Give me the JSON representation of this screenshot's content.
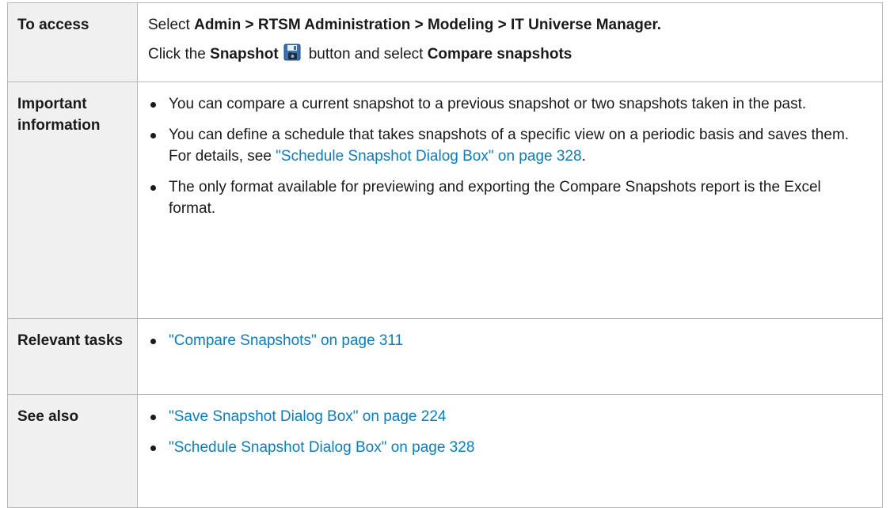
{
  "rows": [
    {
      "label": "To access",
      "line1": {
        "t1": "Select ",
        "path": "Admin > RTSM Administration > Modeling > IT Universe Manager."
      },
      "line2": {
        "t1": "Click the ",
        "b1": "Snapshot",
        "icon": "floppy-camera-icon",
        "t2": "button and select ",
        "b2": "Compare snapshots"
      }
    },
    {
      "label": "Important information",
      "bullets": [
        {
          "text": "You can compare a current snapshot to a previous snapshot or two snapshots taken in the past."
        },
        {
          "text": "You can define a schedule that takes snapshots of a specific view on a periodic basis and saves them. For details, see ",
          "link": "\"Schedule Snapshot Dialog Box\" on page 328",
          "after": "."
        },
        {
          "text": "The only format available for previewing and exporting the Compare Snapshots report is the Excel format."
        }
      ]
    },
    {
      "label": "Relevant tasks",
      "links": [
        "\"Compare Snapshots\" on page 311"
      ]
    },
    {
      "label": "See also",
      "links": [
        "\"Save Snapshot Dialog Box\" on page 224",
        "\"Schedule Snapshot Dialog Box\" on page 328"
      ]
    }
  ],
  "colors": {
    "link": "#0b7dbf",
    "label_background": "#f0f0f0",
    "border": "#b8b8b8"
  }
}
